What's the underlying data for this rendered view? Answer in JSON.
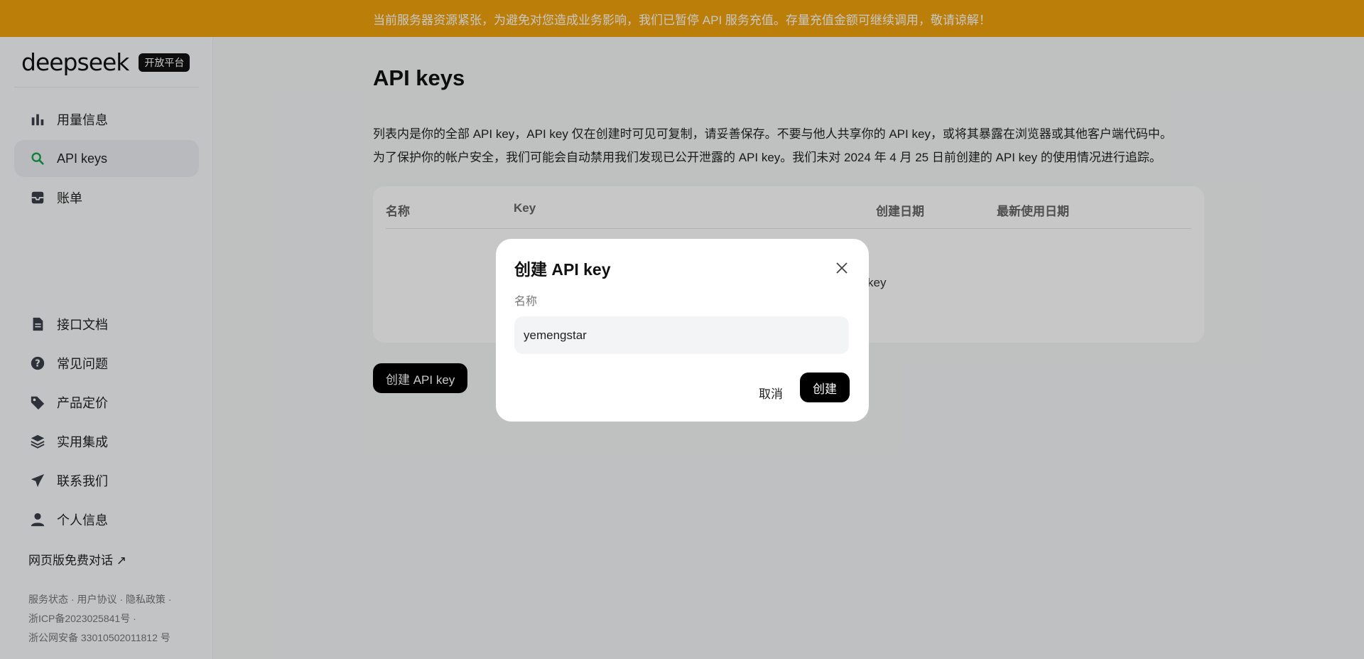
{
  "banner": {
    "text": "当前服务器资源紧张，为避免对您造成业务影响，我们已暂停 API 服务充值。存量充值金额可继续调用，敬请谅解！"
  },
  "brand": {
    "logo": "deepseek",
    "badge": "开放平台"
  },
  "sidebar": {
    "top_items": [
      {
        "label": "用量信息",
        "icon": "bar-chart-icon"
      },
      {
        "label": "API keys",
        "icon": "search-key-icon",
        "active": true
      },
      {
        "label": "账单",
        "icon": "bill-icon"
      }
    ],
    "bottom_items": [
      {
        "label": "接口文档",
        "icon": "document-icon"
      },
      {
        "label": "常见问题",
        "icon": "question-icon"
      },
      {
        "label": "产品定价",
        "icon": "tag-icon"
      },
      {
        "label": "实用集成",
        "icon": "layers-icon"
      },
      {
        "label": "联系我们",
        "icon": "send-icon"
      },
      {
        "label": "个人信息",
        "icon": "user-icon"
      }
    ],
    "web_link": "网页版免费对话 ↗",
    "footer": {
      "links": [
        "服务状态",
        "用户协议",
        "隐私政策"
      ],
      "icp": "浙ICP备2023025841号 ·",
      "police": "浙公网安备 33010502011812 号"
    }
  },
  "main": {
    "title": "API keys",
    "desc_line1": "列表内是你的全部 API key，API key 仅在创建时可见可复制，请妥善保存。不要与他人共享你的 API key，或将其暴露在浏览器或其他客户端代码中。",
    "desc_line2": "为了保护你的帐户安全，我们可能会自动禁用我们发现已公开泄露的 API key。我们未对 2024 年 4 月 25 日前创建的 API key 的使用情况进行追踪。",
    "table": {
      "headers": [
        "名称",
        "Key",
        "创建日期",
        "最新使用日期"
      ],
      "empty_tail": "key"
    },
    "create_button": "创建 API key"
  },
  "modal": {
    "title": "创建 API key",
    "label": "名称",
    "input_value": "yemengstar",
    "cancel": "取消",
    "confirm": "创建"
  },
  "colors": {
    "banner": "#f0a20c",
    "active_icon": "#16a34a",
    "primary_button": "#000000"
  }
}
